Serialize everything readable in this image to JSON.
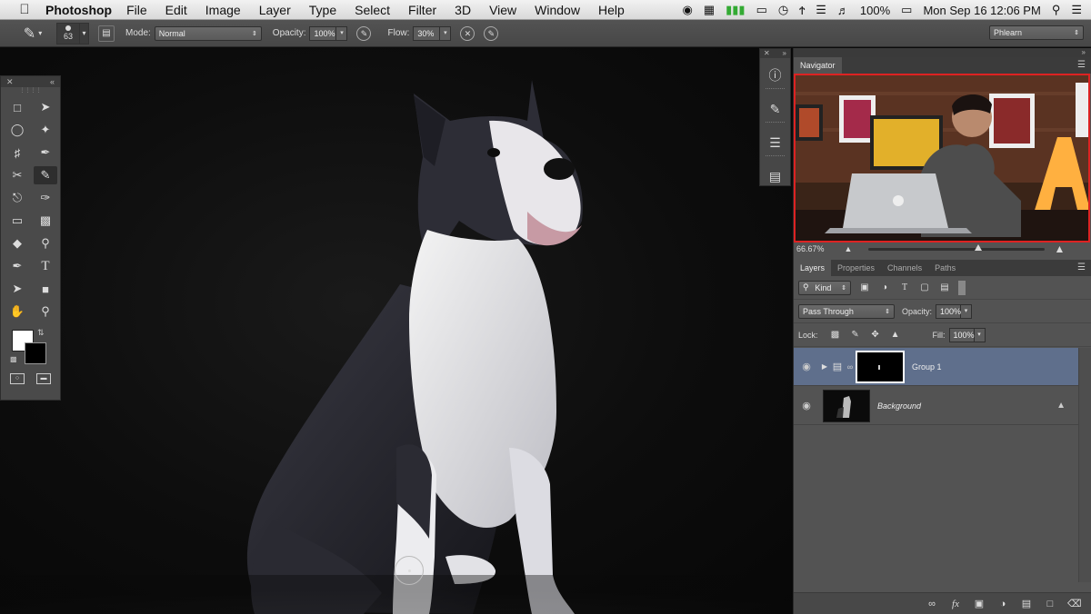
{
  "menubar": {
    "apple": "",
    "app_name": "Photoshop",
    "menus": [
      "File",
      "Edit",
      "Image",
      "Layer",
      "Type",
      "Select",
      "Filter",
      "3D",
      "View",
      "Window",
      "Help"
    ],
    "battery": "100%",
    "clock": "Mon Sep 16  12:06 PM"
  },
  "options_bar": {
    "brush_size": "63",
    "mode_label": "Mode:",
    "mode_value": "Normal",
    "opacity_label": "Opacity:",
    "opacity_value": "100%",
    "flow_label": "Flow:",
    "flow_value": "30%",
    "workspace": "Phlearn"
  },
  "navigator": {
    "tab": "Navigator",
    "zoom": "66.67%",
    "zoom_level": 0.62
  },
  "layers_panel": {
    "tabs": [
      "Layers",
      "Properties",
      "Channels",
      "Paths"
    ],
    "filter_kind": "Kind",
    "blend_mode": "Pass Through",
    "opacity_label": "Opacity:",
    "opacity_value": "100%",
    "lock_label": "Lock:",
    "fill_label": "Fill:",
    "fill_value": "100%",
    "layers": [
      {
        "name": "Group 1",
        "type": "group",
        "selected": true
      },
      {
        "name": "Background",
        "type": "background",
        "locked": true
      }
    ]
  },
  "colors": {
    "foreground": "#ffffff",
    "background": "#000000",
    "selection": "#5f6f8c"
  }
}
